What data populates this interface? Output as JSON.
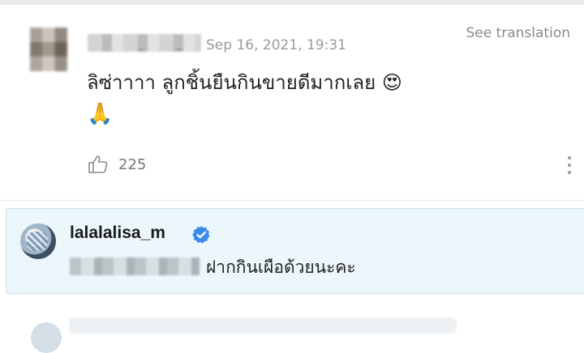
{
  "comment": {
    "timestamp": "Sep 16, 2021, 19:31",
    "see_translation": "See translation",
    "text": "ลิซ่าาาา ลูกชิ้นยืนกินขายดีมากเลย",
    "emoji_inline": "😍",
    "emoji_line2": "🙏",
    "like_count": "225"
  },
  "reply": {
    "username": "lalalalisa_m",
    "text": "ฝากกินเผือด้วยนะคะ"
  },
  "colors": {
    "verified": "#3b8beb",
    "reply_bg": "#ecf7fc"
  }
}
